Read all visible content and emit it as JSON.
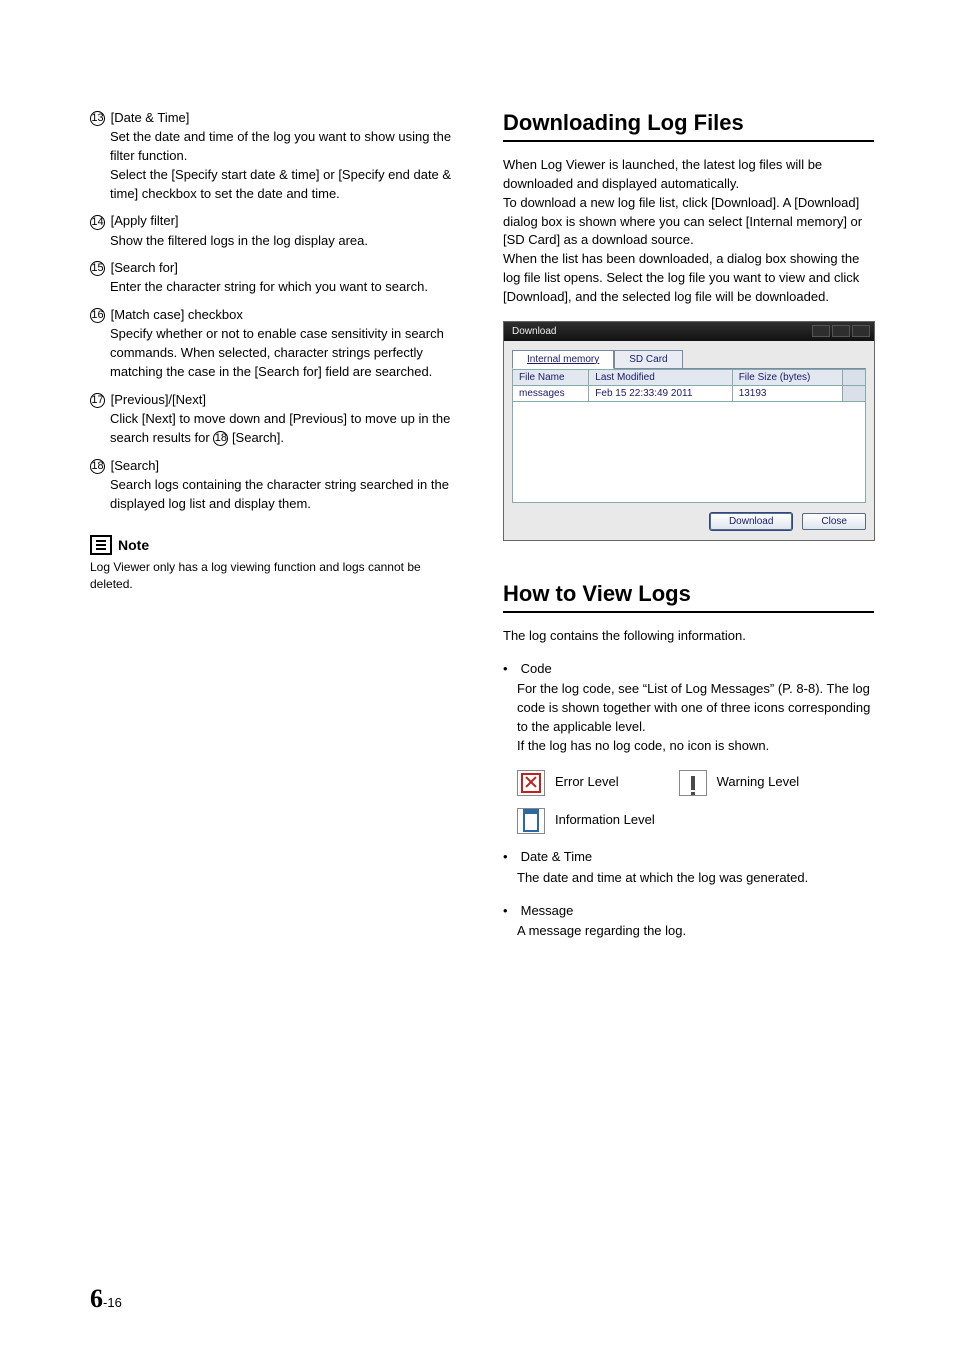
{
  "left": {
    "items": [
      {
        "num": "13",
        "title": "[Date & Time]",
        "body": "Set the date and time of the log you want to show using the filter function.\nSelect the [Specify start date & time] or [Specify end date & time] checkbox to set the date and time."
      },
      {
        "num": "14",
        "title": "[Apply filter]",
        "body": "Show the filtered logs in the log display area."
      },
      {
        "num": "15",
        "title": "[Search for]",
        "body": "Enter the character string for which you want to search."
      },
      {
        "num": "16",
        "title": "[Match case] checkbox",
        "body": "Specify whether or not to enable case sensitivity in search commands.  When selected, character strings perfectly matching the case in the [Search for] field are searched."
      },
      {
        "num": "17",
        "title": "[Previous]/[Next]",
        "body_pre": "Click [Next] to move down and [Previous] to move up in the search results for ",
        "body_ref_num": "18",
        "body_post": " [Search]."
      },
      {
        "num": "18",
        "title": "[Search]",
        "body": "Search logs containing the character string searched in the displayed log list and display them."
      }
    ],
    "note_label": "Note",
    "note_body": "Log Viewer only has a log viewing function and logs cannot be deleted."
  },
  "right": {
    "h_download": "Downloading Log Files",
    "p_download": "When Log Viewer is launched, the latest log files will be downloaded and displayed automatically.\nTo download a new log file list, click [Download]. A [Download] dialog box is shown where you can select [Internal memory] or [SD Card] as a download source.\nWhen the list has been downloaded, a dialog box showing the log file list opens. Select the log file you want to view and click [Download], and the selected log file will be downloaded.",
    "dialog": {
      "title": "Download",
      "tabs": [
        "Internal memory",
        "SD Card"
      ],
      "active_tab": 0,
      "headers": [
        "File Name",
        "Last Modified",
        "File Size (bytes)"
      ],
      "rows": [
        {
          "file": "messages",
          "modified": "Feb 15 22:33:49 2011",
          "size": "13193"
        }
      ],
      "buttons": {
        "download": "Download",
        "close": "Close"
      }
    },
    "h_view": "How to View Logs",
    "p_view": "The log contains the following information.",
    "bullets": [
      {
        "title": "Code",
        "body": "For the log code, see “List of Log Messages” (P. 8-8). The log code is shown together with one of three icons corresponding to the applicable level.\nIf the log has no log code, no icon is shown."
      },
      {
        "title": "Date & Time",
        "body": "The date and time at which the log was generated."
      },
      {
        "title": "Message",
        "body": "A message regarding the log."
      }
    ],
    "levels": {
      "error": "Error Level",
      "warning": "Warning Level",
      "info": "Information Level"
    }
  },
  "footer": {
    "chapter": "6",
    "sep": "-",
    "page": "16"
  }
}
